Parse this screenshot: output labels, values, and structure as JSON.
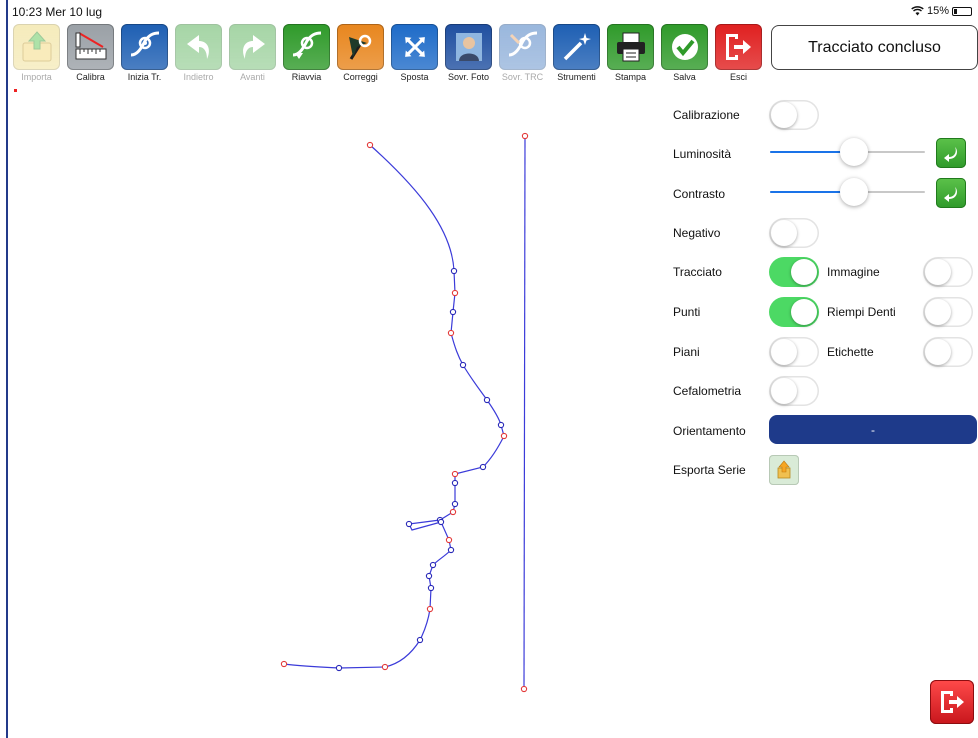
{
  "status_bar": {
    "time": "10:23",
    "date": "Mer 10 lug",
    "battery": "15%"
  },
  "toolbar": [
    {
      "id": "importa",
      "label": "Importa",
      "icon": "folder-import-icon",
      "disabled": true,
      "color": "#e9d36a"
    },
    {
      "id": "calibra",
      "label": "Calibra",
      "icon": "ruler-calibrate-icon",
      "disabled": false,
      "color": "#9aa0a6"
    },
    {
      "id": "inizia",
      "label": "Inizia Tr.",
      "icon": "start-trace-icon",
      "disabled": false,
      "color": "#1e5fb3"
    },
    {
      "id": "indietro",
      "label": "Indietro",
      "icon": "undo-arrow-icon",
      "disabled": true,
      "color": "#3aa23a"
    },
    {
      "id": "avanti",
      "label": "Avanti",
      "icon": "redo-arrow-icon",
      "disabled": true,
      "color": "#3aa23a"
    },
    {
      "id": "riavvia",
      "label": "Riavvia",
      "icon": "restart-icon",
      "disabled": false,
      "color": "#2f9a2a"
    },
    {
      "id": "correggi",
      "label": "Correggi",
      "icon": "correct-cursor-icon",
      "disabled": false,
      "color": "#e8861e"
    },
    {
      "id": "sposta",
      "label": "Sposta",
      "icon": "move-arrows-icon",
      "disabled": false,
      "color": "#1e6bc8"
    },
    {
      "id": "sovr_foto",
      "label": "Sovr. Foto",
      "icon": "photo-overlay-icon",
      "disabled": false,
      "color": "#1f4fa0"
    },
    {
      "id": "sovr_trc",
      "label": "Sovr. TRC",
      "icon": "trc-overlay-icon",
      "disabled": true,
      "color": "#1e5fb3"
    },
    {
      "id": "strumenti",
      "label": "Strumenti",
      "icon": "magic-wand-icon",
      "disabled": false,
      "color": "#1e5fb3"
    },
    {
      "id": "stampa",
      "label": "Stampa",
      "icon": "printer-icon",
      "disabled": false,
      "color": "#2f9a2a"
    },
    {
      "id": "salva",
      "label": "Salva",
      "icon": "checkmark-save-icon",
      "disabled": false,
      "color": "#2f9a2a"
    },
    {
      "id": "esci",
      "label": "Esci",
      "icon": "exit-door-icon",
      "disabled": false,
      "color": "#e02020"
    }
  ],
  "status_message": "Tracciato concluso",
  "panel": {
    "calibrazione": {
      "label": "Calibrazione",
      "on": false
    },
    "luminosita": {
      "label": "Luminosità",
      "value": 0.55
    },
    "contrasto": {
      "label": "Contrasto",
      "value": 0.55
    },
    "negativo": {
      "label": "Negativo",
      "on": false
    },
    "tracciato": {
      "label": "Tracciato",
      "on": true
    },
    "immagine": {
      "label": "Immagine",
      "on": false
    },
    "punti": {
      "label": "Punti",
      "on": true
    },
    "riempi_denti": {
      "label": "Riempi Denti",
      "on": false
    },
    "piani": {
      "label": "Piani",
      "on": false
    },
    "etichette": {
      "label": "Etichette",
      "on": false
    },
    "cefalometria": {
      "label": "Cefalometria",
      "on": false
    },
    "orientamento": {
      "label": "Orientamento",
      "value": "-"
    },
    "esporta_serie": {
      "label": "Esporta Serie"
    }
  },
  "colors": {
    "trace_line": "#3b3bd9",
    "red_point": "#e33a3a",
    "blue_point": "#2a2ab8",
    "toggle_on": "#4cd964",
    "orient_bg": "#1e3a8a"
  }
}
